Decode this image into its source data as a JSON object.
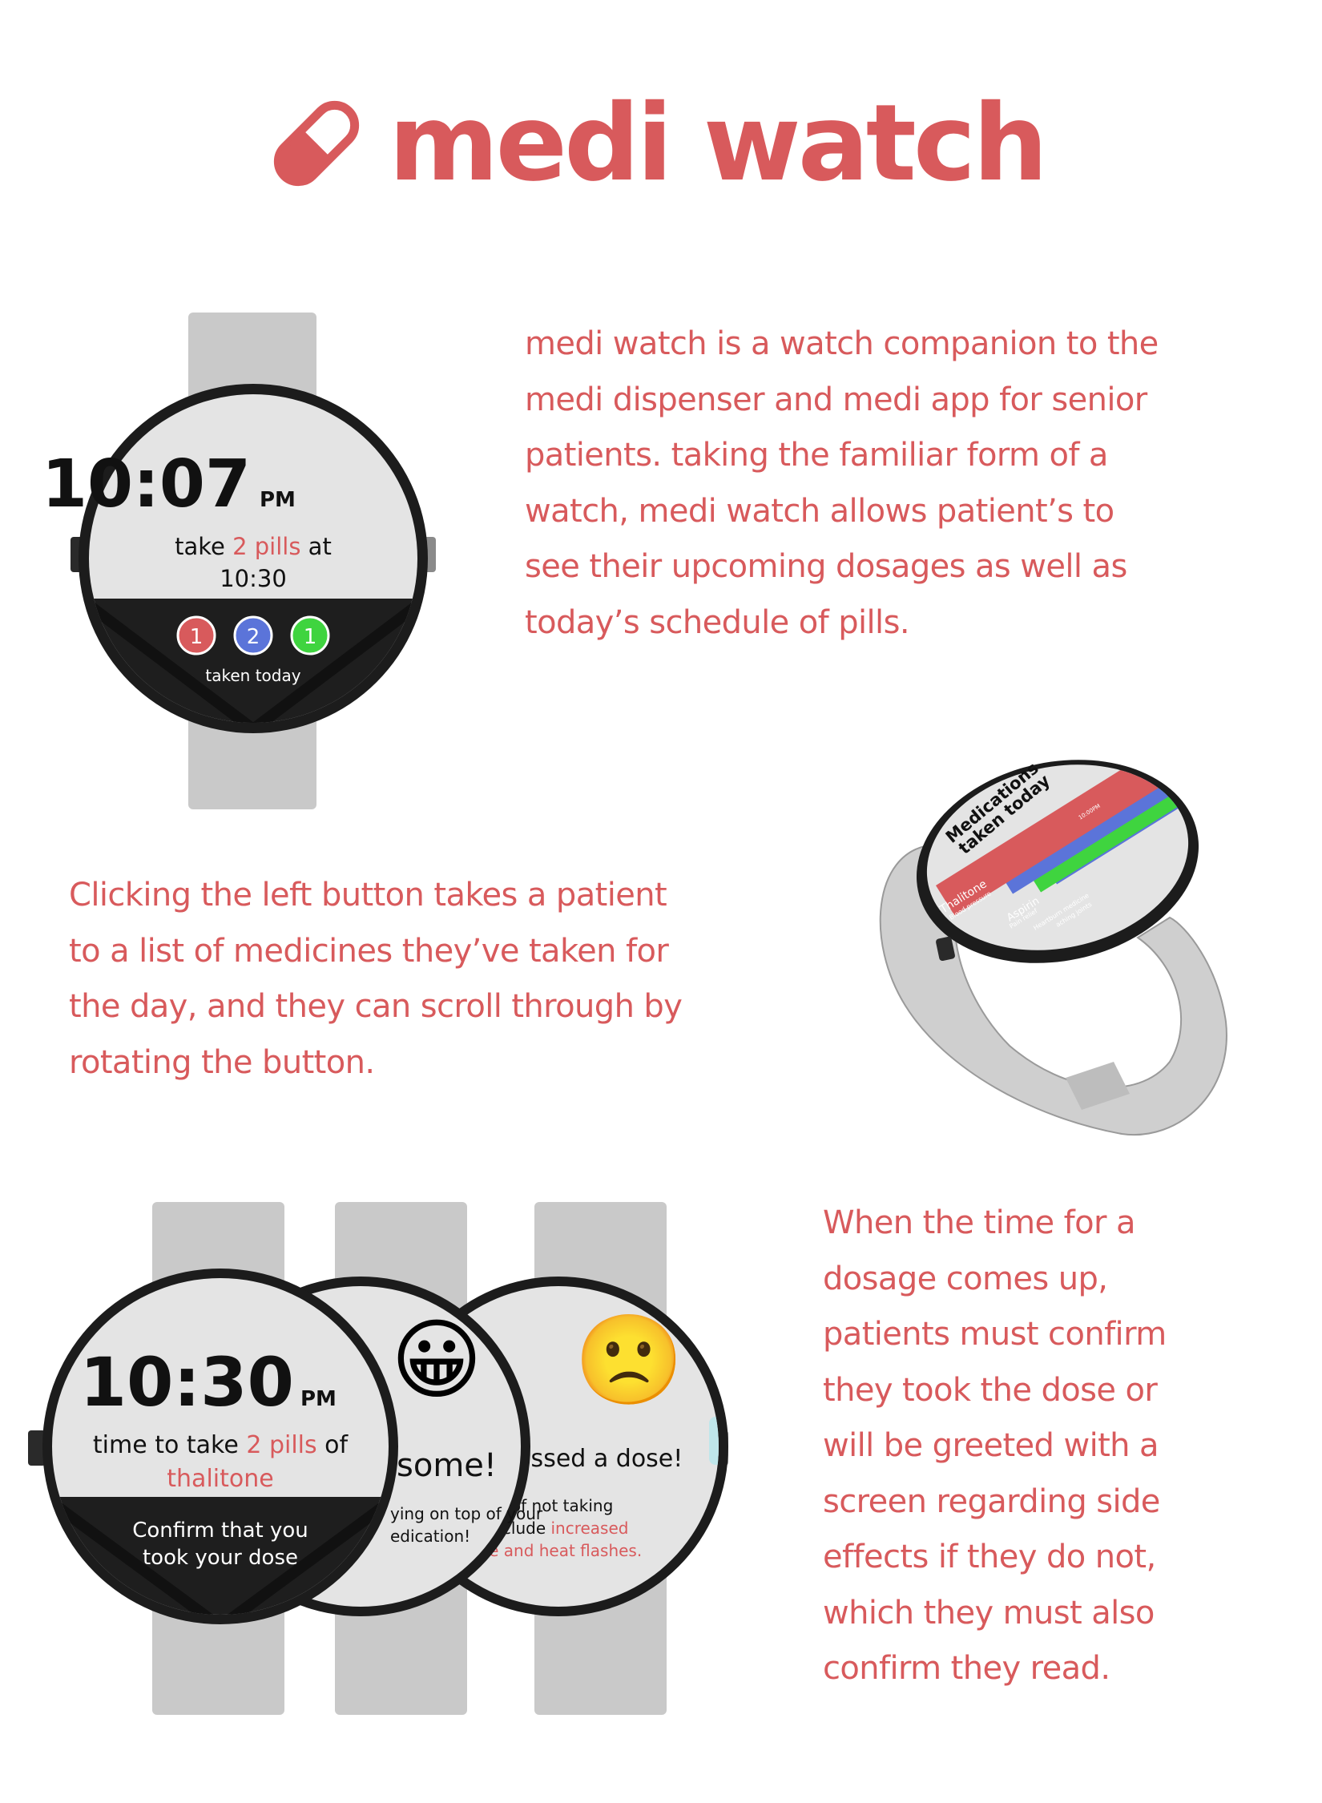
{
  "header": {
    "title": "medi watch"
  },
  "intro": {
    "lines": [
      "medi watch is a watch companion to the",
      "medi dispenser and medi app for senior",
      "patients. taking the familiar form of a",
      "watch, medi watch allows patient’s to",
      "see their upcoming dosages as well as",
      "today’s schedule of pills."
    ]
  },
  "watch_home": {
    "time": "10:07",
    "ampm": "PM",
    "line1_pre": "take ",
    "line1_highlight": "2 pills",
    "line1_post": " at",
    "line2": "10:30",
    "counts": [
      {
        "value": "1",
        "color": "#d85a5c"
      },
      {
        "value": "2",
        "color": "#5b74d9"
      },
      {
        "value": "1",
        "color": "#3fd43f"
      }
    ],
    "footer": "taken today"
  },
  "medications_watch": {
    "title_line1": "Medications",
    "title_line2": "taken today",
    "cards": [
      {
        "name": "Thalitone",
        "detail": "Blood pressure",
        "time": "10:00PM",
        "color": "#d85a5c"
      },
      {
        "name": "Aspirin",
        "detail": "Pain relief",
        "time": "",
        "color": "#5b74d9"
      },
      {
        "name": "",
        "detail": "Heartburn medicine",
        "time": "",
        "color": "#3fd43f"
      },
      {
        "name": "",
        "detail": "aching joints",
        "time": "",
        "color": "#5b74d9"
      }
    ]
  },
  "list_description": {
    "lines": [
      "Clicking the left button takes a patient",
      "to a list of medicines they’ve taken for",
      "the day, and they can scroll through by",
      "rotating the button."
    ]
  },
  "dose_watch": {
    "time": "10:30",
    "ampm": "PM",
    "line1_pre": "time to take ",
    "line1_highlight": "2 pills",
    "line1_post": " of",
    "line2": "thalitone",
    "footer_line1": "Confirm that you",
    "footer_line2": "took your dose"
  },
  "awesome_watch": {
    "emoji": "😀",
    "headline": "some!",
    "body_line1": "ying on top of your",
    "body_line2": "edication!"
  },
  "missed_watch": {
    "emoji": "🙁",
    "headline": "missed a dose!",
    "body_line1": "ects of not taking",
    "body_line2_pre": "e include ",
    "body_line2_highlight": "increased",
    "body_line3": "ate and heat flashes."
  },
  "confirm_description": {
    "lines": [
      "When the time for a",
      "dosage comes up,",
      "patients must confirm",
      "they took the dose or",
      "will be greeted with a",
      "screen regarding side",
      "effects if they do not,",
      "which they must also",
      "confirm they read."
    ]
  },
  "colors": {
    "accent": "#d85a5c",
    "blue": "#5b74d9",
    "green": "#3fd43f",
    "band": "#c9c9c9",
    "screen": "#e4e4e4",
    "dark": "#1e1e1e"
  }
}
